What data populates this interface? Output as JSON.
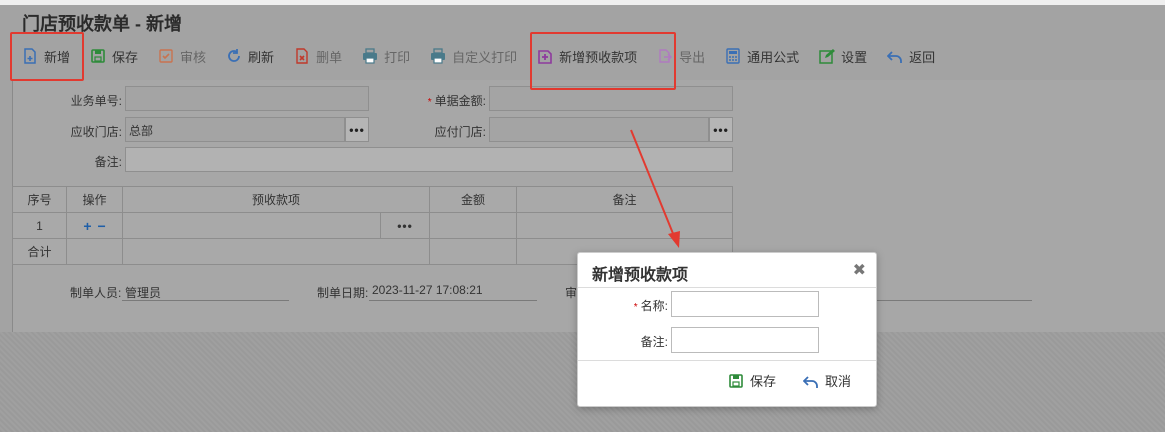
{
  "page": {
    "title": "门店预收款单 - 新增"
  },
  "toolbar": {
    "buttons": [
      {
        "label": "新增",
        "icon": "new-doc-icon",
        "color": "#3a6fb5"
      },
      {
        "label": "保存",
        "icon": "save-icon",
        "color": "#2e8b3a"
      },
      {
        "label": "审核",
        "icon": "audit-icon",
        "color": "#c9734f"
      },
      {
        "label": "刷新",
        "icon": "refresh-icon",
        "color": "#3a6fb5"
      },
      {
        "label": "删单",
        "icon": "delete-doc-icon",
        "color": "#c0392b"
      },
      {
        "label": "打印",
        "icon": "print-icon",
        "color": "#4a7a8a"
      },
      {
        "label": "自定义打印",
        "icon": "custom-print-icon",
        "color": "#4a7a8a"
      },
      {
        "label": "新增预收款项",
        "icon": "add-item-icon",
        "color": "#8e3a9e"
      },
      {
        "label": "导出",
        "icon": "export-icon",
        "color": "#8e3a9e"
      },
      {
        "label": "通用公式",
        "icon": "formula-icon",
        "color": "#3a6fb5"
      },
      {
        "label": "设置",
        "icon": "settings-edit-icon",
        "color": "#2e8b3a"
      },
      {
        "label": "返回",
        "icon": "back-icon",
        "color": "#3a6fb5"
      }
    ]
  },
  "form": {
    "business_no_label": "业务单号:",
    "business_no_value": "",
    "amount_label": "单据金额:",
    "amount_value": "",
    "receivable_store_label": "应收门店:",
    "receivable_store_value": "总部",
    "payable_store_label": "应付门店:",
    "payable_store_value": "",
    "remark_label": "备注:",
    "remark_value": "",
    "browse_label": "•••"
  },
  "grid": {
    "headers": [
      "序号",
      "操作",
      "预收款项",
      "金额",
      "备注"
    ],
    "row": {
      "index": "1",
      "add": "+",
      "remove": "−",
      "item": "",
      "amount": "",
      "remark": ""
    },
    "total_label": "合计"
  },
  "footer": {
    "maker_label": "制单人员:",
    "maker_value": "管理员",
    "date_label": "制单日期:",
    "date_value": "2023-11-27 17:08:21",
    "auditor_label": "审"
  },
  "dialog": {
    "title": "新增预收款项",
    "close_glyph": "✖",
    "name_label": "名称:",
    "name_value": "",
    "remark_label": "备注:",
    "remark_value": "",
    "save_label": "保存",
    "cancel_label": "取消"
  },
  "annotation": {
    "highlight_color": "#e23a30"
  }
}
